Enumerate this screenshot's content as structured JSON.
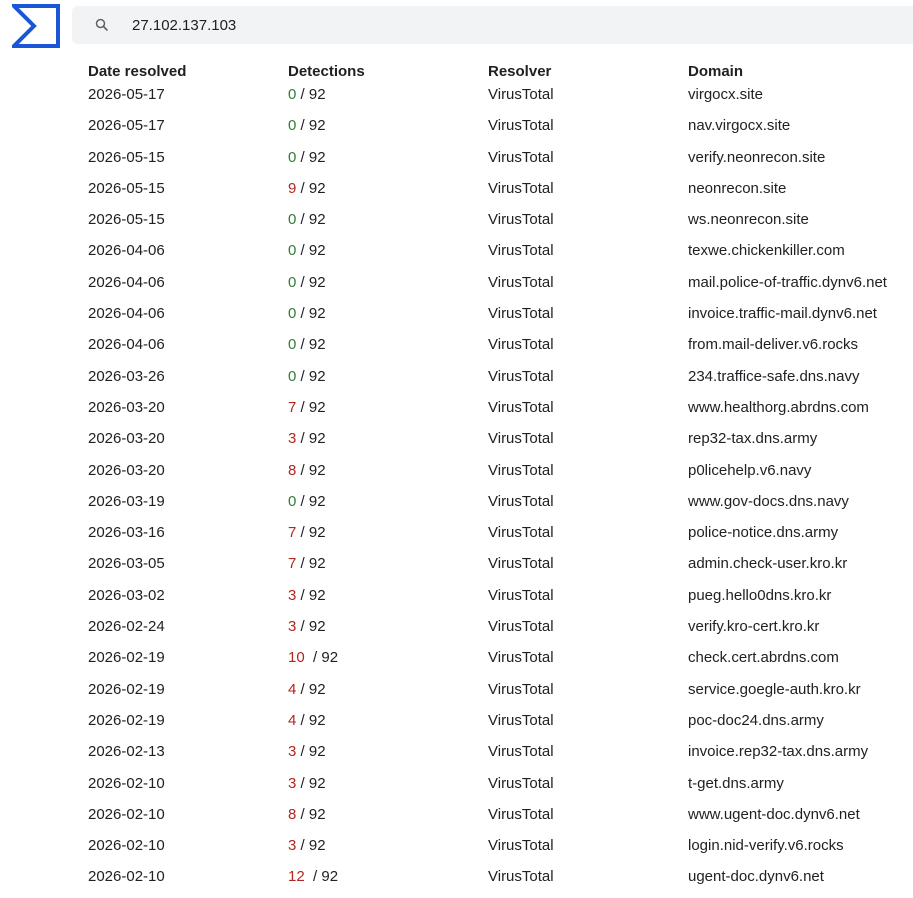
{
  "search": {
    "value": "27.102.137.103"
  },
  "colors": {
    "brand": "#1a56d6",
    "clean": "#2e7d32",
    "malicious": "#b3261e"
  },
  "table": {
    "headers": {
      "date": "Date resolved",
      "detections": "Detections",
      "resolver": "Resolver",
      "domain": "Domain"
    },
    "rows": [
      {
        "date": "2026-05-17",
        "detections": "0",
        "total": " / 92",
        "resolver": "VirusTotal",
        "domain": "virgocx.site"
      },
      {
        "date": "2026-05-17",
        "detections": "0",
        "total": " / 92",
        "resolver": "VirusTotal",
        "domain": "nav.virgocx.site"
      },
      {
        "date": "2026-05-15",
        "detections": "0",
        "total": " / 92",
        "resolver": "VirusTotal",
        "domain": "verify.neonrecon.site"
      },
      {
        "date": "2026-05-15",
        "detections": "9",
        "total": " / 92",
        "resolver": "VirusTotal",
        "domain": "neonrecon.site"
      },
      {
        "date": "2026-05-15",
        "detections": "0",
        "total": " / 92",
        "resolver": "VirusTotal",
        "domain": "ws.neonrecon.site"
      },
      {
        "date": "2026-04-06",
        "detections": "0",
        "total": " / 92",
        "resolver": "VirusTotal",
        "domain": "texwe.chickenkiller.com"
      },
      {
        "date": "2026-04-06",
        "detections": "0",
        "total": " / 92",
        "resolver": "VirusTotal",
        "domain": "mail.police-of-traffic.dynv6.net"
      },
      {
        "date": "2026-04-06",
        "detections": "0",
        "total": " / 92",
        "resolver": "VirusTotal",
        "domain": "invoice.traffic-mail.dynv6.net"
      },
      {
        "date": "2026-04-06",
        "detections": "0",
        "total": " / 92",
        "resolver": "VirusTotal",
        "domain": "from.mail-deliver.v6.rocks"
      },
      {
        "date": "2026-03-26",
        "detections": "0",
        "total": " / 92",
        "resolver": "VirusTotal",
        "domain": "234.traffice-safe.dns.navy"
      },
      {
        "date": "2026-03-20",
        "detections": "7",
        "total": " / 92",
        "resolver": "VirusTotal",
        "domain": "www.healthorg.abrdns.com"
      },
      {
        "date": "2026-03-20",
        "detections": "3",
        "total": " / 92",
        "resolver": "VirusTotal",
        "domain": "rep32-tax.dns.army"
      },
      {
        "date": "2026-03-20",
        "detections": "8",
        "total": " / 92",
        "resolver": "VirusTotal",
        "domain": "p0licehelp.v6.navy"
      },
      {
        "date": "2026-03-19",
        "detections": "0",
        "total": " / 92",
        "resolver": "VirusTotal",
        "domain": "www.gov-docs.dns.navy"
      },
      {
        "date": "2026-03-16",
        "detections": "7",
        "total": " / 92",
        "resolver": "VirusTotal",
        "domain": "police-notice.dns.army"
      },
      {
        "date": "2026-03-05",
        "detections": "7",
        "total": " / 92",
        "resolver": "VirusTotal",
        "domain": "admin.check-user.kro.kr"
      },
      {
        "date": "2026-03-02",
        "detections": "3",
        "total": " / 92",
        "resolver": "VirusTotal",
        "domain": "pueg.hello0dns.kro.kr"
      },
      {
        "date": "2026-02-24",
        "detections": "3",
        "total": " / 92",
        "resolver": "VirusTotal",
        "domain": "verify.kro-cert.kro.kr"
      },
      {
        "date": "2026-02-19",
        "detections": "10",
        "total": "  / 92",
        "resolver": "VirusTotal",
        "domain": "check.cert.abrdns.com"
      },
      {
        "date": "2026-02-19",
        "detections": "4",
        "total": " / 92",
        "resolver": "VirusTotal",
        "domain": "service.goegle-auth.kro.kr"
      },
      {
        "date": "2026-02-19",
        "detections": "4",
        "total": " / 92",
        "resolver": "VirusTotal",
        "domain": "poc-doc24.dns.army"
      },
      {
        "date": "2026-02-13",
        "detections": "3",
        "total": " / 92",
        "resolver": "VirusTotal",
        "domain": "invoice.rep32-tax.dns.army"
      },
      {
        "date": "2026-02-10",
        "detections": "3",
        "total": " / 92",
        "resolver": "VirusTotal",
        "domain": "t-get.dns.army"
      },
      {
        "date": "2026-02-10",
        "detections": "8",
        "total": " / 92",
        "resolver": "VirusTotal",
        "domain": "www.ugent-doc.dynv6.net"
      },
      {
        "date": "2026-02-10",
        "detections": "3",
        "total": " / 92",
        "resolver": "VirusTotal",
        "domain": "login.nid-verify.v6.rocks"
      },
      {
        "date": "2026-02-10",
        "detections": "12",
        "total": "  / 92",
        "resolver": "VirusTotal",
        "domain": "ugent-doc.dynv6.net"
      }
    ]
  }
}
